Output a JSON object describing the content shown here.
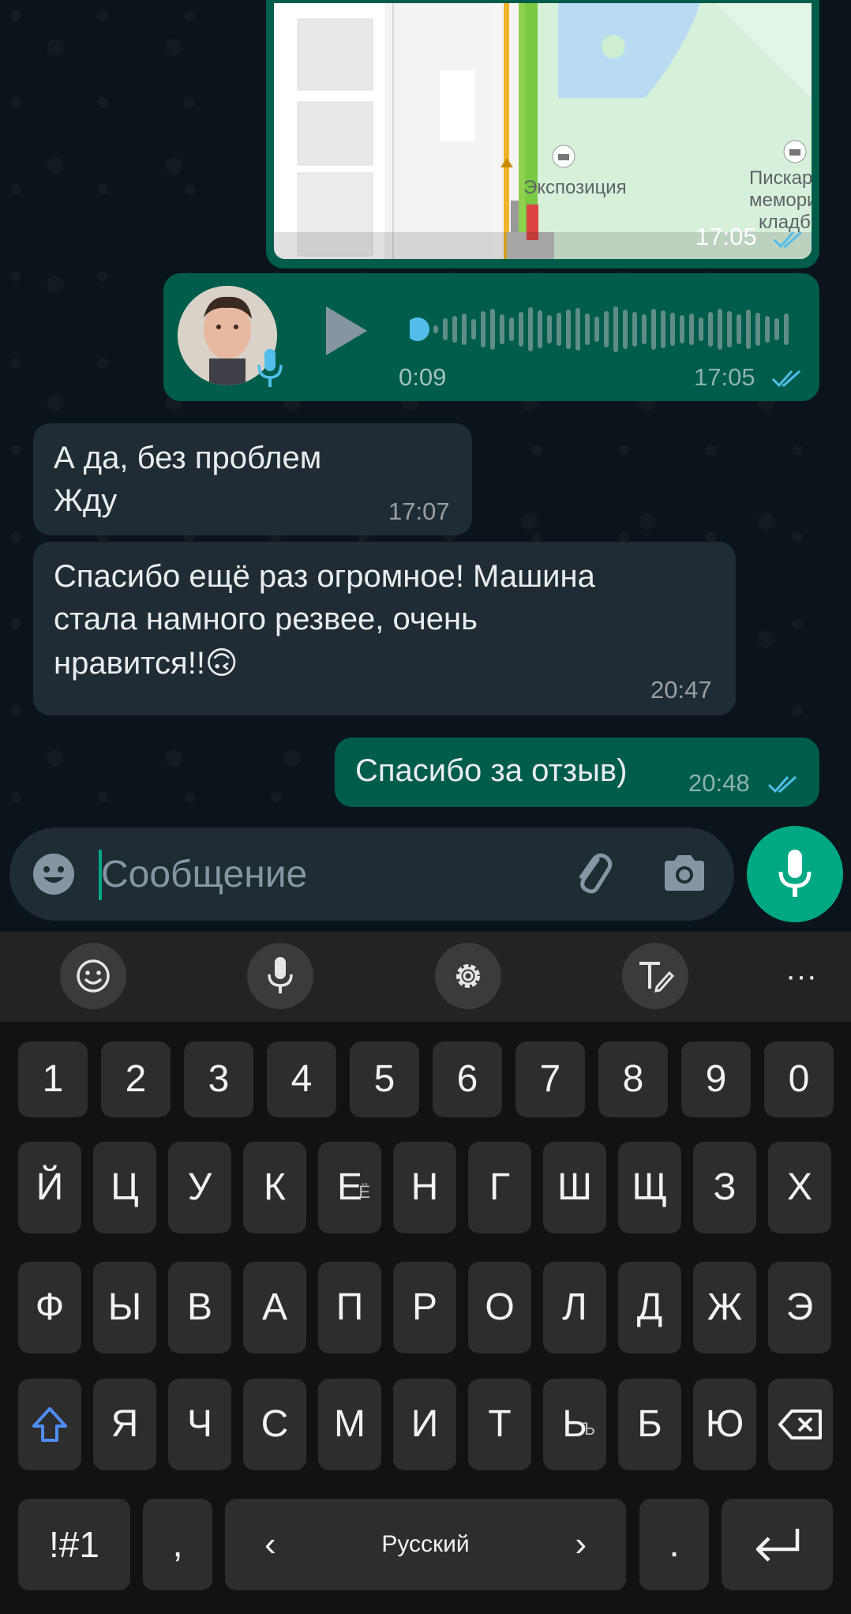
{
  "map_message": {
    "labels": [
      "Экспозиция",
      "Пискарё",
      "мемориа",
      "кладби"
    ],
    "time": "17:05"
  },
  "voice_message": {
    "duration": "0:09",
    "time": "17:05",
    "progress": 0.0
  },
  "messages": [
    {
      "direction": "incoming",
      "lines": [
        "А да, без проблем",
        "Жду"
      ],
      "time": "17:07"
    },
    {
      "direction": "incoming",
      "lines": [
        "Спасибо ещё раз огромное! Машина",
        "стала намного резвее, очень",
        "нравится!!🙃"
      ],
      "time": "20:47"
    },
    {
      "direction": "outgoing",
      "lines": [
        "Спасибо за отзыв)"
      ],
      "time": "20:48"
    }
  ],
  "composer": {
    "placeholder": "Сообщение",
    "icons": [
      "emoji-icon",
      "attach-icon",
      "camera-icon",
      "mic-icon"
    ]
  },
  "keyboard": {
    "toolbar": [
      "emoji-icon",
      "voice-input-icon",
      "settings-icon",
      "handwriting-icon",
      "more-icon"
    ],
    "more_label": "···",
    "number_row": [
      "1",
      "2",
      "3",
      "4",
      "5",
      "6",
      "7",
      "8",
      "9",
      "0"
    ],
    "row1": [
      "Й",
      "Ц",
      "У",
      "К",
      "Е",
      "Н",
      "Г",
      "Ш",
      "Щ",
      "З",
      "Х"
    ],
    "row1_sub": {
      "Е": "Ё"
    },
    "row2": [
      "Ф",
      "Ы",
      "В",
      "А",
      "П",
      "Р",
      "О",
      "Л",
      "Д",
      "Ж",
      "Э"
    ],
    "row3": [
      "Я",
      "Ч",
      "С",
      "М",
      "И",
      "Т",
      "Ь",
      "Б",
      "Ю"
    ],
    "row3_sub": {
      "Ь": "Ъ"
    },
    "symbols_label": "!#1",
    "comma_label": ",",
    "language_label": "Русский",
    "left_arrow": "‹",
    "right_arrow": "›",
    "period_label": ".",
    "colors": {
      "accent": "#00a884",
      "outgoing": "#005c4b",
      "incoming": "#202c33",
      "ticks": "#53bdeb"
    }
  }
}
